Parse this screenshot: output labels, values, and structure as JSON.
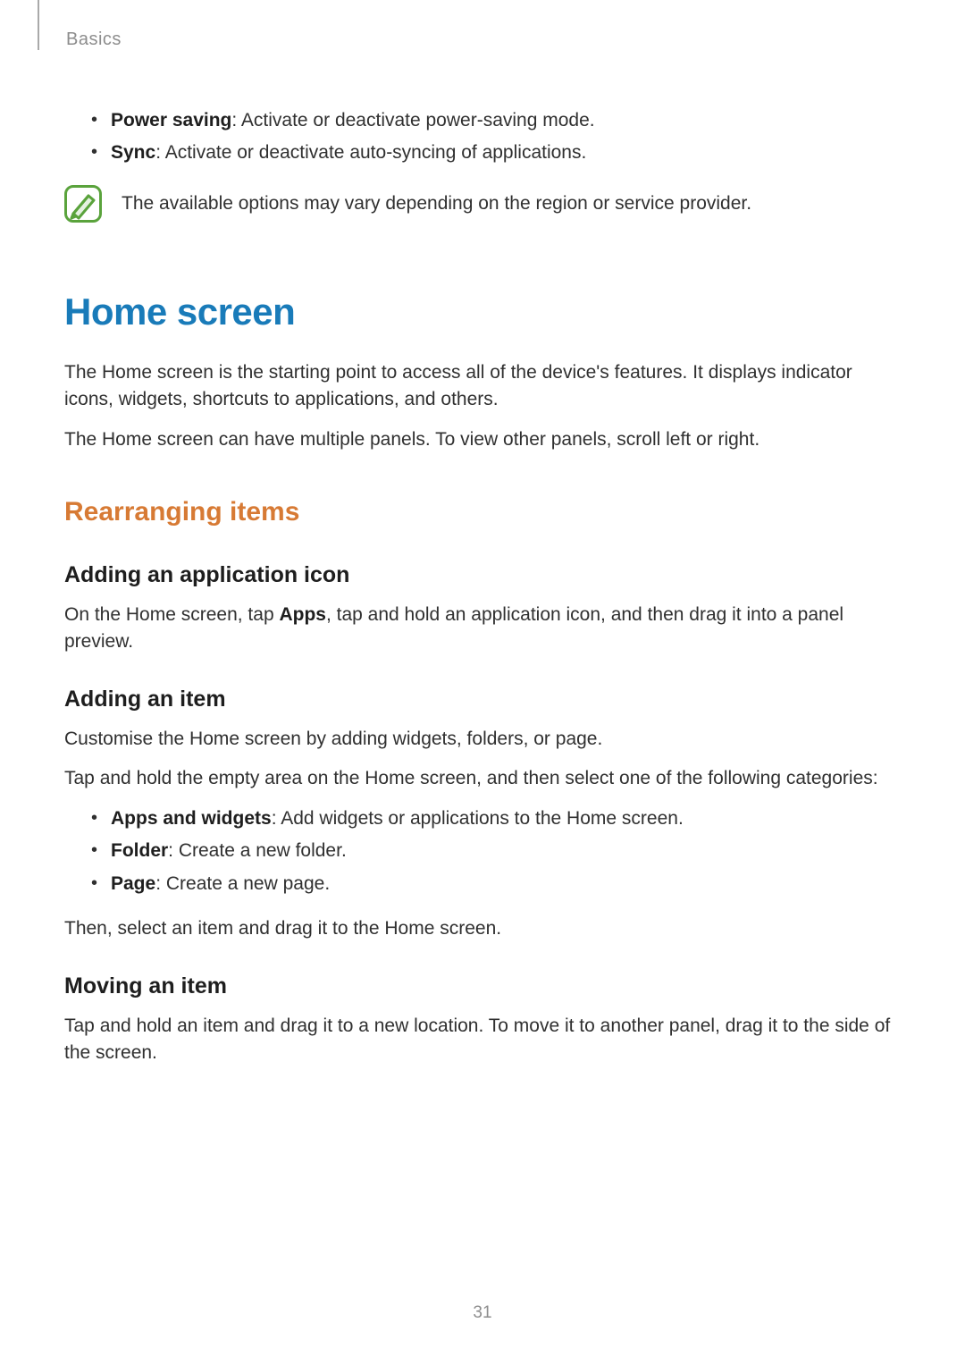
{
  "header": {
    "breadcrumb": "Basics"
  },
  "topBullets": [
    {
      "term": "Power saving",
      "desc": ": Activate or deactivate power-saving mode."
    },
    {
      "term": "Sync",
      "desc": ": Activate or deactivate auto-syncing of applications."
    }
  ],
  "note": {
    "text": "The available options may vary depending on the region or service provider."
  },
  "section": {
    "title": "Home screen",
    "para1": "The Home screen is the starting point to access all of the device's features. It displays indicator icons, widgets, shortcuts to applications, and others.",
    "para2": "The Home screen can have multiple panels. To view other panels, scroll left or right."
  },
  "subsection": {
    "title": "Rearranging items",
    "adding_app": {
      "title": "Adding an application icon",
      "pre": "On the Home screen, tap ",
      "bold": "Apps",
      "post": ", tap and hold an application icon, and then drag it into a panel preview."
    },
    "adding_item": {
      "title": "Adding an item",
      "para1": "Customise the Home screen by adding widgets, folders, or page.",
      "para2": "Tap and hold the empty area on the Home screen, and then select one of the following categories:",
      "bullets": [
        {
          "term": "Apps and widgets",
          "desc": ": Add widgets or applications to the Home screen."
        },
        {
          "term": "Folder",
          "desc": ": Create a new folder."
        },
        {
          "term": "Page",
          "desc": ": Create a new page."
        }
      ],
      "para3": "Then, select an item and drag it to the Home screen."
    },
    "moving_item": {
      "title": "Moving an item",
      "para": "Tap and hold an item and drag it to a new location. To move it to another panel, drag it to the side of the screen."
    }
  },
  "pageNumber": "31"
}
